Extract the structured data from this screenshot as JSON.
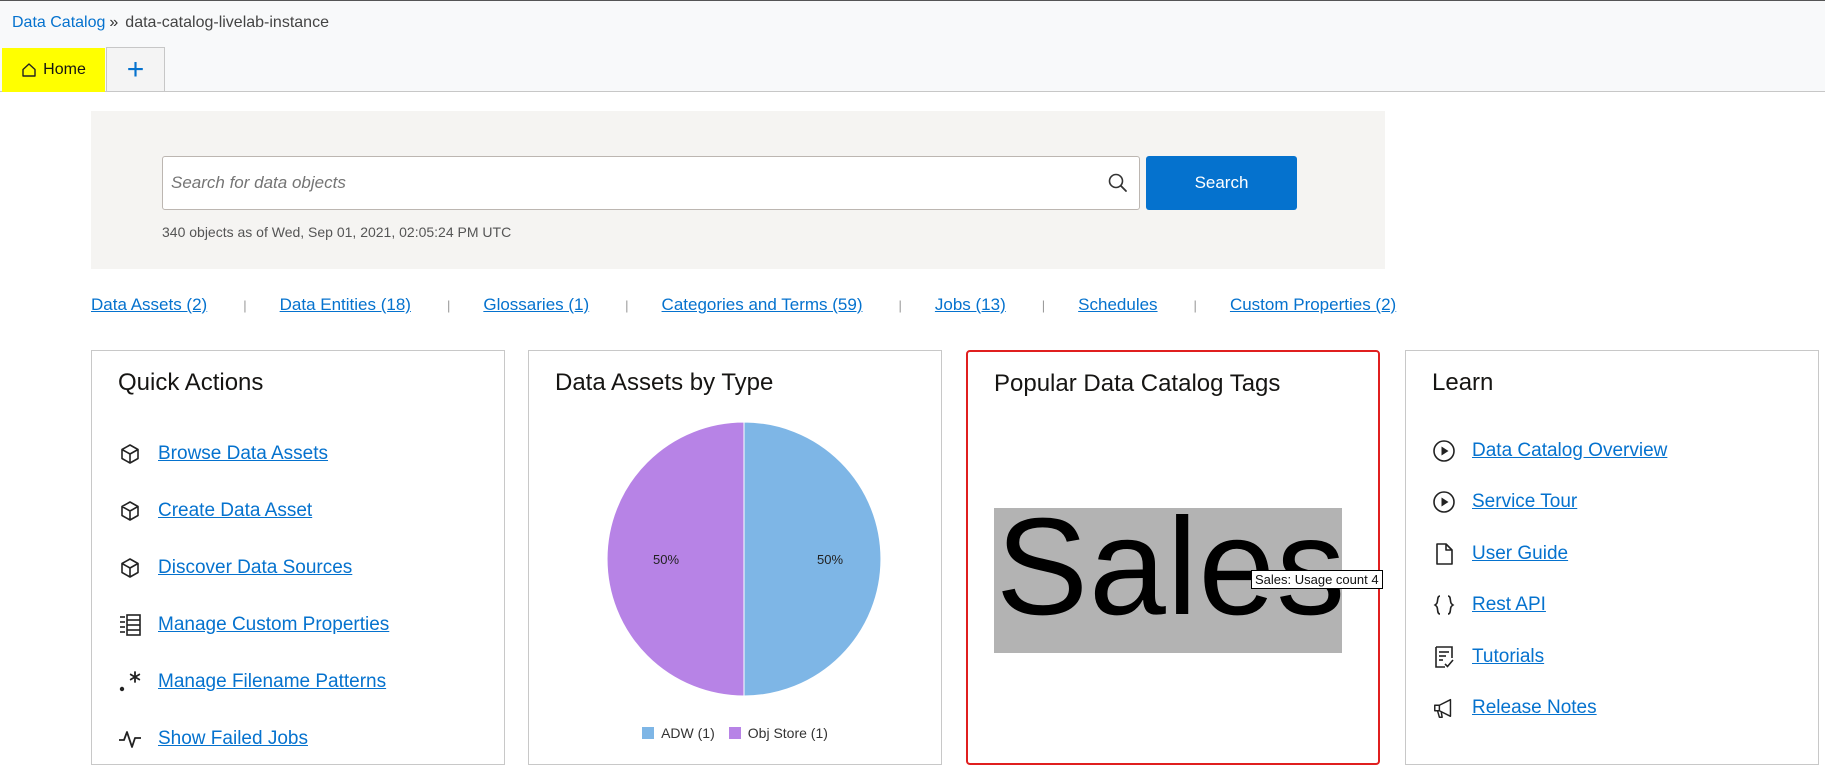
{
  "breadcrumb": {
    "root": "Data Catalog",
    "separator": "»",
    "current": "data-catalog-livelab-instance"
  },
  "tabs": {
    "home_label": "Home",
    "add_label": "+"
  },
  "search": {
    "placeholder": "Search for data objects",
    "button_label": "Search",
    "object_count_text": "340 objects as of Wed, Sep 01, 2021, 02:05:24 PM UTC"
  },
  "summary_links": [
    "Data Assets (2)",
    "Data Entities (18)",
    "Glossaries (1)",
    "Categories and Terms (59)",
    "Jobs (13)",
    "Schedules",
    "Custom Properties (2)"
  ],
  "summary_divider": "|",
  "quick_actions": {
    "title": "Quick Actions",
    "items": [
      {
        "label": "Browse Data Assets",
        "icon": "cube-icon"
      },
      {
        "label": "Create Data Asset",
        "icon": "cube-icon"
      },
      {
        "label": "Discover Data Sources",
        "icon": "cube-icon"
      },
      {
        "label": "Manage Custom Properties",
        "icon": "list-icon"
      },
      {
        "label": "Manage Filename Patterns",
        "icon": "regex-icon"
      },
      {
        "label": "Show Failed Jobs",
        "icon": "pulse-icon"
      }
    ]
  },
  "data_assets_by_type": {
    "title": "Data Assets by Type",
    "slice_label_left": "50%",
    "slice_label_right": "50%",
    "legend": [
      {
        "label": "ADW (1)",
        "color": "#7eb6e6"
      },
      {
        "label": "Obj Store (1)",
        "color": "#b783e6"
      }
    ]
  },
  "chart_data": {
    "type": "pie",
    "categories": [
      "ADW",
      "Obj Store"
    ],
    "values": [
      1,
      1
    ],
    "percent_labels": [
      "50%",
      "50%"
    ],
    "colors": [
      "#7eb6e6",
      "#b783e6"
    ],
    "legend_position": "bottom"
  },
  "popular_tags": {
    "title": "Popular Data Catalog Tags",
    "tag": "Sales",
    "tooltip": "Sales: Usage count 4"
  },
  "learn": {
    "title": "Learn",
    "items": [
      {
        "label": "Data Catalog Overview",
        "icon": "play-circle-icon"
      },
      {
        "label": "Service Tour",
        "icon": "play-circle-icon"
      },
      {
        "label": "User Guide",
        "icon": "document-icon"
      },
      {
        "label": "Rest API",
        "icon": "braces-icon"
      },
      {
        "label": "Tutorials",
        "icon": "checklist-icon"
      },
      {
        "label": "Release Notes",
        "icon": "megaphone-icon"
      }
    ]
  }
}
